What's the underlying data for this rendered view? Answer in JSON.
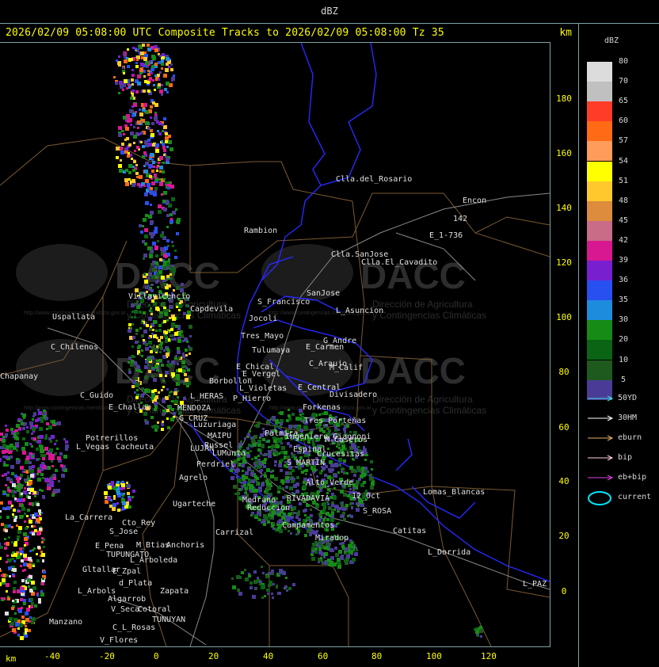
{
  "header": {
    "units": "dBZ"
  },
  "title": {
    "text": "2026/02/09 05:08:00 UTC Composite Tracks to 2026/02/09 05:08:00 Tz 35",
    "unit": "km"
  },
  "y_axis": {
    "ticks": [
      "180",
      "160",
      "140",
      "120",
      "100",
      "80",
      "60",
      "40",
      "20",
      "0"
    ]
  },
  "x_axis": {
    "unit": "km",
    "ticks": [
      "-40",
      "-20",
      "0",
      "20",
      "40",
      "60",
      "80",
      "100",
      "120"
    ]
  },
  "legend": {
    "title": "dBZ",
    "levels": [
      {
        "label": "80",
        "color": "#dcdcdc"
      },
      {
        "label": "70",
        "color": "#c0c0c0"
      },
      {
        "label": "65",
        "color": "#ff3c28"
      },
      {
        "label": "60",
        "color": "#ff6a14"
      },
      {
        "label": "57",
        "color": "#ff9c5c"
      },
      {
        "label": "54",
        "color": "#ffff00"
      },
      {
        "label": "51",
        "color": "#ffc82c"
      },
      {
        "label": "48",
        "color": "#dc8c3c"
      },
      {
        "label": "45",
        "color": "#c86c88"
      },
      {
        "label": "42",
        "color": "#d81890"
      },
      {
        "label": "39",
        "color": "#7820d0"
      },
      {
        "label": "36",
        "color": "#2850f0"
      },
      {
        "label": "35",
        "color": "#1e8cdc"
      },
      {
        "label": "30",
        "color": "#168c16"
      },
      {
        "label": "20",
        "color": "#0a6414"
      },
      {
        "label": "10",
        "color": "#1e5a1e"
      },
      {
        "label": "5",
        "color": "#4a3c96"
      }
    ],
    "tracks": [
      {
        "label": "50YD",
        "color": "#40e0e0"
      },
      {
        "label": "30HM",
        "color": "#ffffff"
      },
      {
        "label": "eburn",
        "color": "#e8b070"
      },
      {
        "label": "bip",
        "color": "#ffd0e0"
      },
      {
        "label": "eb+bip",
        "color": "#e040e0"
      }
    ],
    "current": {
      "label": "current",
      "color": "#00e8ff"
    }
  },
  "watermark": {
    "logo": "DACC",
    "org_line1": "Dirección de Agricultura",
    "org_line2": "y Contingencias Climáticas",
    "url": "http://www.contingencias.mendoza.gov.ar"
  },
  "places": [
    "Clla.del_Rosario",
    "Encon",
    "142",
    "E_1-736",
    "Rambion",
    "Clla.SanJose",
    "Clla.El_Cavadito",
    "Villavicencio",
    "Uspallata",
    "Capdevila",
    "S_Francisco",
    "SanJose",
    "L_Asuncion",
    "Jocoli",
    "C_Chilenos",
    "Tres_Mayo",
    "Tulumaya",
    "E_Carmen",
    "G_Andre",
    "E_Chical",
    "E_Vergel",
    "C_Araujo",
    "M_Calif",
    "Borbollon",
    "L_Violetas",
    "E_Central",
    "Divisadero",
    "C_Guido",
    "L_HERAS",
    "P_Hierro",
    "Forkenas",
    "E_Challao",
    "MENDOZA",
    "G_CRUZ",
    "Luzuriaga",
    "MAIPU",
    "Russel",
    "Potrerillos",
    "L_Vegas",
    "Cacheuta",
    "LUJAN",
    "LUMunta",
    "Perdriel",
    "Agrelo",
    "S_MARTIN",
    "Ugarteche",
    "Lomas_Blancas",
    "S_ROSA",
    "12_Oct",
    "RIVADAVIA",
    "Reduccion",
    "La_Carrera",
    "Cto_Rey",
    "S_Jose",
    "Carrizal",
    "E_Pena",
    "TUPUNGATO",
    "M_Btias",
    "Anchoris",
    "L_Arboleda",
    "Gltallar",
    "E_Zpal",
    "d_Plata",
    "L_Arbols",
    "Algarrob",
    "Zapata",
    "V_Seca",
    "Cotoral",
    "TUNUYAN",
    "Manzano",
    "C_L_Rosas",
    "V_Flores",
    "Catitas",
    "L_Dorrida",
    "L_PAZ",
    "Miradop",
    "Campamentos",
    "Medrano",
    "Alto_Verde",
    "Tres_Porteñas",
    "Palmira",
    "M_Caseros",
    "Ingeniero_Giagnoni",
    "Espinal",
    "Crucesitas",
    "Chapanay",
    "aredás"
  ]
}
